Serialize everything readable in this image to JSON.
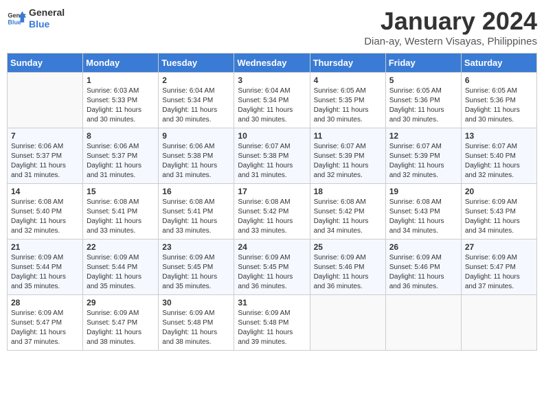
{
  "header": {
    "logo_line1": "General",
    "logo_line2": "Blue",
    "title": "January 2024",
    "subtitle": "Dian-ay, Western Visayas, Philippines"
  },
  "columns": [
    "Sunday",
    "Monday",
    "Tuesday",
    "Wednesday",
    "Thursday",
    "Friday",
    "Saturday"
  ],
  "weeks": [
    [
      {
        "day": "",
        "info": ""
      },
      {
        "day": "1",
        "info": "Sunrise: 6:03 AM\nSunset: 5:33 PM\nDaylight: 11 hours\nand 30 minutes."
      },
      {
        "day": "2",
        "info": "Sunrise: 6:04 AM\nSunset: 5:34 PM\nDaylight: 11 hours\nand 30 minutes."
      },
      {
        "day": "3",
        "info": "Sunrise: 6:04 AM\nSunset: 5:34 PM\nDaylight: 11 hours\nand 30 minutes."
      },
      {
        "day": "4",
        "info": "Sunrise: 6:05 AM\nSunset: 5:35 PM\nDaylight: 11 hours\nand 30 minutes."
      },
      {
        "day": "5",
        "info": "Sunrise: 6:05 AM\nSunset: 5:36 PM\nDaylight: 11 hours\nand 30 minutes."
      },
      {
        "day": "6",
        "info": "Sunrise: 6:05 AM\nSunset: 5:36 PM\nDaylight: 11 hours\nand 30 minutes."
      }
    ],
    [
      {
        "day": "7",
        "info": "Sunrise: 6:06 AM\nSunset: 5:37 PM\nDaylight: 11 hours\nand 31 minutes."
      },
      {
        "day": "8",
        "info": "Sunrise: 6:06 AM\nSunset: 5:37 PM\nDaylight: 11 hours\nand 31 minutes."
      },
      {
        "day": "9",
        "info": "Sunrise: 6:06 AM\nSunset: 5:38 PM\nDaylight: 11 hours\nand 31 minutes."
      },
      {
        "day": "10",
        "info": "Sunrise: 6:07 AM\nSunset: 5:38 PM\nDaylight: 11 hours\nand 31 minutes."
      },
      {
        "day": "11",
        "info": "Sunrise: 6:07 AM\nSunset: 5:39 PM\nDaylight: 11 hours\nand 32 minutes."
      },
      {
        "day": "12",
        "info": "Sunrise: 6:07 AM\nSunset: 5:39 PM\nDaylight: 11 hours\nand 32 minutes."
      },
      {
        "day": "13",
        "info": "Sunrise: 6:07 AM\nSunset: 5:40 PM\nDaylight: 11 hours\nand 32 minutes."
      }
    ],
    [
      {
        "day": "14",
        "info": "Sunrise: 6:08 AM\nSunset: 5:40 PM\nDaylight: 11 hours\nand 32 minutes."
      },
      {
        "day": "15",
        "info": "Sunrise: 6:08 AM\nSunset: 5:41 PM\nDaylight: 11 hours\nand 33 minutes."
      },
      {
        "day": "16",
        "info": "Sunrise: 6:08 AM\nSunset: 5:41 PM\nDaylight: 11 hours\nand 33 minutes."
      },
      {
        "day": "17",
        "info": "Sunrise: 6:08 AM\nSunset: 5:42 PM\nDaylight: 11 hours\nand 33 minutes."
      },
      {
        "day": "18",
        "info": "Sunrise: 6:08 AM\nSunset: 5:42 PM\nDaylight: 11 hours\nand 34 minutes."
      },
      {
        "day": "19",
        "info": "Sunrise: 6:08 AM\nSunset: 5:43 PM\nDaylight: 11 hours\nand 34 minutes."
      },
      {
        "day": "20",
        "info": "Sunrise: 6:09 AM\nSunset: 5:43 PM\nDaylight: 11 hours\nand 34 minutes."
      }
    ],
    [
      {
        "day": "21",
        "info": "Sunrise: 6:09 AM\nSunset: 5:44 PM\nDaylight: 11 hours\nand 35 minutes."
      },
      {
        "day": "22",
        "info": "Sunrise: 6:09 AM\nSunset: 5:44 PM\nDaylight: 11 hours\nand 35 minutes."
      },
      {
        "day": "23",
        "info": "Sunrise: 6:09 AM\nSunset: 5:45 PM\nDaylight: 11 hours\nand 35 minutes."
      },
      {
        "day": "24",
        "info": "Sunrise: 6:09 AM\nSunset: 5:45 PM\nDaylight: 11 hours\nand 36 minutes."
      },
      {
        "day": "25",
        "info": "Sunrise: 6:09 AM\nSunset: 5:46 PM\nDaylight: 11 hours\nand 36 minutes."
      },
      {
        "day": "26",
        "info": "Sunrise: 6:09 AM\nSunset: 5:46 PM\nDaylight: 11 hours\nand 36 minutes."
      },
      {
        "day": "27",
        "info": "Sunrise: 6:09 AM\nSunset: 5:47 PM\nDaylight: 11 hours\nand 37 minutes."
      }
    ],
    [
      {
        "day": "28",
        "info": "Sunrise: 6:09 AM\nSunset: 5:47 PM\nDaylight: 11 hours\nand 37 minutes."
      },
      {
        "day": "29",
        "info": "Sunrise: 6:09 AM\nSunset: 5:47 PM\nDaylight: 11 hours\nand 38 minutes."
      },
      {
        "day": "30",
        "info": "Sunrise: 6:09 AM\nSunset: 5:48 PM\nDaylight: 11 hours\nand 38 minutes."
      },
      {
        "day": "31",
        "info": "Sunrise: 6:09 AM\nSunset: 5:48 PM\nDaylight: 11 hours\nand 39 minutes."
      },
      {
        "day": "",
        "info": ""
      },
      {
        "day": "",
        "info": ""
      },
      {
        "day": "",
        "info": ""
      }
    ]
  ]
}
